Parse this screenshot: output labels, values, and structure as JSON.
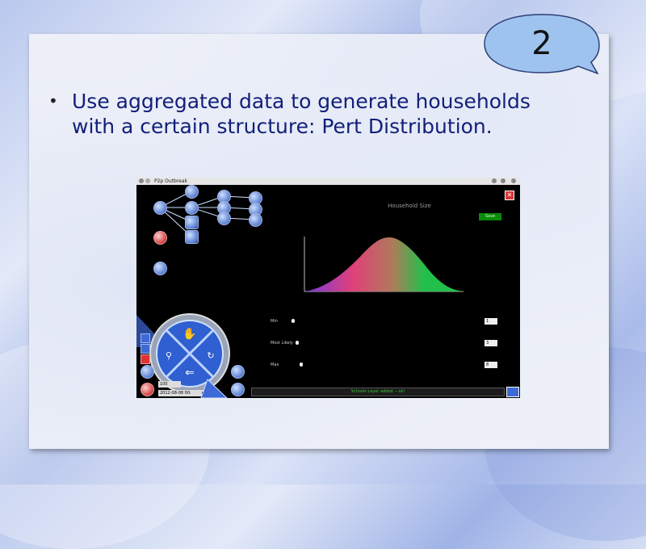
{
  "slide": {
    "number": "2",
    "bullet": "Use aggregated data to generate households with a certain structure: Pert Distribution.",
    "bullet_marker": "•"
  },
  "app": {
    "window_title": "P2p Outbreak",
    "close_glyph": "✕",
    "chart": {
      "title": "Household Size"
    },
    "save_label": "Save",
    "sliders": [
      {
        "label": "Min",
        "value": "1"
      },
      {
        "label": "Most Likely",
        "value": "3"
      },
      {
        "label": "Max",
        "value": "8"
      }
    ],
    "status": "Schools Layer added -- ok!",
    "zoom": "100",
    "date": "2012-08-08 00:"
  },
  "icons": {
    "network": "network-icon",
    "nav": "navigation-wheel-icon",
    "chart": "bar-chart-icon"
  },
  "colors": {
    "title_text": "#13207a",
    "badge_fill": "#9ec3ee",
    "app_bg": "#000000",
    "curve_left": "#7a3ad8",
    "curve_mid": "#e0407a",
    "curve_right": "#22c04a"
  }
}
